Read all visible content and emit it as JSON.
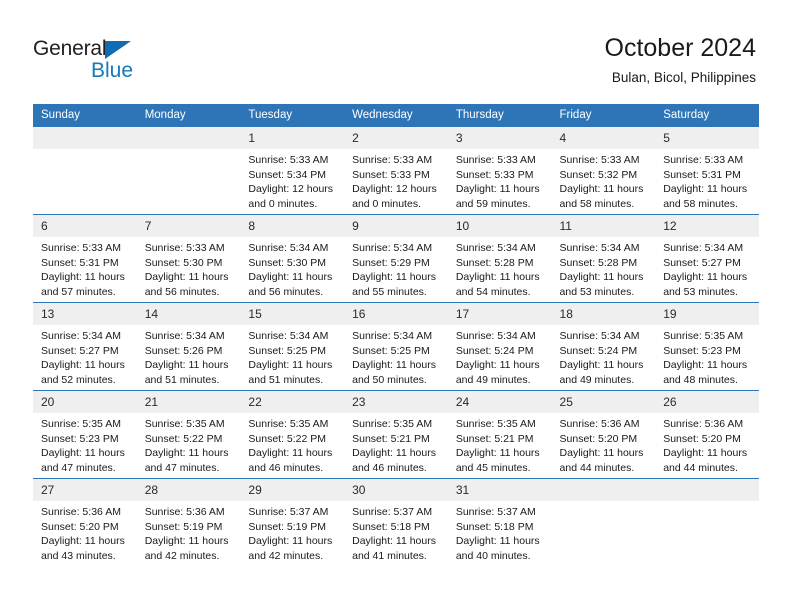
{
  "brand": {
    "name_top": "General",
    "name_bottom": "Blue",
    "accent_color": "#1479bd"
  },
  "header": {
    "title": "October 2024",
    "subtitle": "Bulan, Bicol, Philippines",
    "header_bg": "#2d75b6",
    "daynum_bg": "#efefef"
  },
  "weekday_headers": [
    "Sunday",
    "Monday",
    "Tuesday",
    "Wednesday",
    "Thursday",
    "Friday",
    "Saturday"
  ],
  "labels": {
    "sunrise_prefix": "Sunrise:",
    "sunset_prefix": "Sunset:",
    "daylight_prefix": "Daylight:"
  },
  "weeks": [
    [
      {
        "day": "",
        "sunrise": "",
        "sunset": "",
        "daylight_line1": "",
        "daylight_line2": ""
      },
      {
        "day": "",
        "sunrise": "",
        "sunset": "",
        "daylight_line1": "",
        "daylight_line2": ""
      },
      {
        "day": "1",
        "sunrise": "Sunrise: 5:33 AM",
        "sunset": "Sunset: 5:34 PM",
        "daylight_line1": "Daylight: 12 hours",
        "daylight_line2": "and 0 minutes."
      },
      {
        "day": "2",
        "sunrise": "Sunrise: 5:33 AM",
        "sunset": "Sunset: 5:33 PM",
        "daylight_line1": "Daylight: 12 hours",
        "daylight_line2": "and 0 minutes."
      },
      {
        "day": "3",
        "sunrise": "Sunrise: 5:33 AM",
        "sunset": "Sunset: 5:33 PM",
        "daylight_line1": "Daylight: 11 hours",
        "daylight_line2": "and 59 minutes."
      },
      {
        "day": "4",
        "sunrise": "Sunrise: 5:33 AM",
        "sunset": "Sunset: 5:32 PM",
        "daylight_line1": "Daylight: 11 hours",
        "daylight_line2": "and 58 minutes."
      },
      {
        "day": "5",
        "sunrise": "Sunrise: 5:33 AM",
        "sunset": "Sunset: 5:31 PM",
        "daylight_line1": "Daylight: 11 hours",
        "daylight_line2": "and 58 minutes."
      }
    ],
    [
      {
        "day": "6",
        "sunrise": "Sunrise: 5:33 AM",
        "sunset": "Sunset: 5:31 PM",
        "daylight_line1": "Daylight: 11 hours",
        "daylight_line2": "and 57 minutes."
      },
      {
        "day": "7",
        "sunrise": "Sunrise: 5:33 AM",
        "sunset": "Sunset: 5:30 PM",
        "daylight_line1": "Daylight: 11 hours",
        "daylight_line2": "and 56 minutes."
      },
      {
        "day": "8",
        "sunrise": "Sunrise: 5:34 AM",
        "sunset": "Sunset: 5:30 PM",
        "daylight_line1": "Daylight: 11 hours",
        "daylight_line2": "and 56 minutes."
      },
      {
        "day": "9",
        "sunrise": "Sunrise: 5:34 AM",
        "sunset": "Sunset: 5:29 PM",
        "daylight_line1": "Daylight: 11 hours",
        "daylight_line2": "and 55 minutes."
      },
      {
        "day": "10",
        "sunrise": "Sunrise: 5:34 AM",
        "sunset": "Sunset: 5:28 PM",
        "daylight_line1": "Daylight: 11 hours",
        "daylight_line2": "and 54 minutes."
      },
      {
        "day": "11",
        "sunrise": "Sunrise: 5:34 AM",
        "sunset": "Sunset: 5:28 PM",
        "daylight_line1": "Daylight: 11 hours",
        "daylight_line2": "and 53 minutes."
      },
      {
        "day": "12",
        "sunrise": "Sunrise: 5:34 AM",
        "sunset": "Sunset: 5:27 PM",
        "daylight_line1": "Daylight: 11 hours",
        "daylight_line2": "and 53 minutes."
      }
    ],
    [
      {
        "day": "13",
        "sunrise": "Sunrise: 5:34 AM",
        "sunset": "Sunset: 5:27 PM",
        "daylight_line1": "Daylight: 11 hours",
        "daylight_line2": "and 52 minutes."
      },
      {
        "day": "14",
        "sunrise": "Sunrise: 5:34 AM",
        "sunset": "Sunset: 5:26 PM",
        "daylight_line1": "Daylight: 11 hours",
        "daylight_line2": "and 51 minutes."
      },
      {
        "day": "15",
        "sunrise": "Sunrise: 5:34 AM",
        "sunset": "Sunset: 5:25 PM",
        "daylight_line1": "Daylight: 11 hours",
        "daylight_line2": "and 51 minutes."
      },
      {
        "day": "16",
        "sunrise": "Sunrise: 5:34 AM",
        "sunset": "Sunset: 5:25 PM",
        "daylight_line1": "Daylight: 11 hours",
        "daylight_line2": "and 50 minutes."
      },
      {
        "day": "17",
        "sunrise": "Sunrise: 5:34 AM",
        "sunset": "Sunset: 5:24 PM",
        "daylight_line1": "Daylight: 11 hours",
        "daylight_line2": "and 49 minutes."
      },
      {
        "day": "18",
        "sunrise": "Sunrise: 5:34 AM",
        "sunset": "Sunset: 5:24 PM",
        "daylight_line1": "Daylight: 11 hours",
        "daylight_line2": "and 49 minutes."
      },
      {
        "day": "19",
        "sunrise": "Sunrise: 5:35 AM",
        "sunset": "Sunset: 5:23 PM",
        "daylight_line1": "Daylight: 11 hours",
        "daylight_line2": "and 48 minutes."
      }
    ],
    [
      {
        "day": "20",
        "sunrise": "Sunrise: 5:35 AM",
        "sunset": "Sunset: 5:23 PM",
        "daylight_line1": "Daylight: 11 hours",
        "daylight_line2": "and 47 minutes."
      },
      {
        "day": "21",
        "sunrise": "Sunrise: 5:35 AM",
        "sunset": "Sunset: 5:22 PM",
        "daylight_line1": "Daylight: 11 hours",
        "daylight_line2": "and 47 minutes."
      },
      {
        "day": "22",
        "sunrise": "Sunrise: 5:35 AM",
        "sunset": "Sunset: 5:22 PM",
        "daylight_line1": "Daylight: 11 hours",
        "daylight_line2": "and 46 minutes."
      },
      {
        "day": "23",
        "sunrise": "Sunrise: 5:35 AM",
        "sunset": "Sunset: 5:21 PM",
        "daylight_line1": "Daylight: 11 hours",
        "daylight_line2": "and 46 minutes."
      },
      {
        "day": "24",
        "sunrise": "Sunrise: 5:35 AM",
        "sunset": "Sunset: 5:21 PM",
        "daylight_line1": "Daylight: 11 hours",
        "daylight_line2": "and 45 minutes."
      },
      {
        "day": "25",
        "sunrise": "Sunrise: 5:36 AM",
        "sunset": "Sunset: 5:20 PM",
        "daylight_line1": "Daylight: 11 hours",
        "daylight_line2": "and 44 minutes."
      },
      {
        "day": "26",
        "sunrise": "Sunrise: 5:36 AM",
        "sunset": "Sunset: 5:20 PM",
        "daylight_line1": "Daylight: 11 hours",
        "daylight_line2": "and 44 minutes."
      }
    ],
    [
      {
        "day": "27",
        "sunrise": "Sunrise: 5:36 AM",
        "sunset": "Sunset: 5:20 PM",
        "daylight_line1": "Daylight: 11 hours",
        "daylight_line2": "and 43 minutes."
      },
      {
        "day": "28",
        "sunrise": "Sunrise: 5:36 AM",
        "sunset": "Sunset: 5:19 PM",
        "daylight_line1": "Daylight: 11 hours",
        "daylight_line2": "and 42 minutes."
      },
      {
        "day": "29",
        "sunrise": "Sunrise: 5:37 AM",
        "sunset": "Sunset: 5:19 PM",
        "daylight_line1": "Daylight: 11 hours",
        "daylight_line2": "and 42 minutes."
      },
      {
        "day": "30",
        "sunrise": "Sunrise: 5:37 AM",
        "sunset": "Sunset: 5:18 PM",
        "daylight_line1": "Daylight: 11 hours",
        "daylight_line2": "and 41 minutes."
      },
      {
        "day": "31",
        "sunrise": "Sunrise: 5:37 AM",
        "sunset": "Sunset: 5:18 PM",
        "daylight_line1": "Daylight: 11 hours",
        "daylight_line2": "and 40 minutes."
      },
      {
        "day": "",
        "sunrise": "",
        "sunset": "",
        "daylight_line1": "",
        "daylight_line2": ""
      },
      {
        "day": "",
        "sunrise": "",
        "sunset": "",
        "daylight_line1": "",
        "daylight_line2": ""
      }
    ]
  ]
}
